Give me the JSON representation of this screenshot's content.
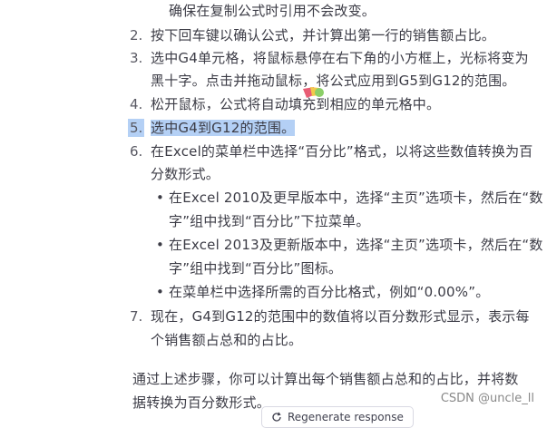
{
  "content": {
    "partial_top": "确保在复制公式时引用不会改变。",
    "steps": [
      {
        "num": "2.",
        "lines": [
          "按下回车键以确认公式，并计算出第一行的销售额占比。"
        ]
      },
      {
        "num": "3.",
        "lines": [
          "选中G4单元格，将鼠标悬停在右下角的小方框上，光标将变为",
          "黑十字。点击并拖动鼠标，将公式应用到G5到G12的范围。"
        ]
      },
      {
        "num": "4.",
        "lines": [
          "松开鼠标，公式将自动填充到相应的单元格中。"
        ]
      },
      {
        "num": "5.",
        "lines": [
          "选中G4到G12的范围。"
        ]
      },
      {
        "num": "6.",
        "lines": [
          "在Excel的菜单栏中选择“百分比”格式，以将这些数值转换为百",
          "分数形式。"
        ]
      },
      {
        "num": "7.",
        "lines": [
          "现在，G4到G12的范围中的数值将以百分数形式显示，表示每",
          "个销售额占总和的占比。"
        ]
      }
    ],
    "bullets": [
      {
        "lines": [
          "在Excel 2010及更早版本中，选择“主页”选项卡，然后在“数",
          "字”组中找到“百分比”下拉菜单。"
        ]
      },
      {
        "lines": [
          "在Excel 2013及更新版本中，选择“主页”选项卡，然后在“数",
          "字”组中找到“百分比”图标。"
        ]
      },
      {
        "lines": [
          "在菜单栏中选择所需的百分比格式，例如“0.00%”。"
        ]
      }
    ],
    "summary_lines": [
      "通过上述步骤，你可以计算出每个销售额占总和的占比，并将数",
      "据转换为百分数形式。"
    ]
  },
  "regenerate": {
    "label": "Regenerate response",
    "icon": "refresh-icon"
  },
  "watermark": "CSDN @uncle_ll",
  "colors": {
    "text": "#3c3c46",
    "selection": "#b4d0f5",
    "background": "#ffffff"
  }
}
